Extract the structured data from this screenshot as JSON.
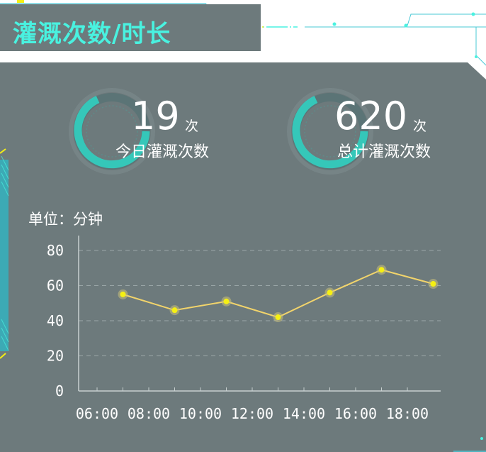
{
  "header": {
    "title": "灌溉次数/时长"
  },
  "stats": [
    {
      "value": "19",
      "unit": "次",
      "label": "今日灌溉次数"
    },
    {
      "value": "620",
      "unit": "次",
      "label": "总计灌溉次数"
    }
  ],
  "chart_unit_label": "单位：分钟",
  "colors": {
    "panel": "#6d7a7c",
    "accent": "#49f2e0",
    "line": "#f2d46b",
    "point": "#f5f013"
  },
  "chart_data": {
    "type": "line",
    "categories": [
      "06:00",
      "08:00",
      "10:00",
      "12:00",
      "14:00",
      "16:00",
      "18:00"
    ],
    "x": [
      "06:00",
      "07:00",
      "08:00",
      "09:00",
      "10:00",
      "11:00",
      "12:00",
      "13:00",
      "14:00",
      "15:00",
      "16:00",
      "17:00",
      "18:00"
    ],
    "series": [
      {
        "x": [
          "07:00",
          "09:00",
          "11:00",
          "13:00",
          "15:00",
          "17:00",
          "19:00"
        ],
        "values": [
          55,
          46,
          51,
          42,
          56,
          69,
          61
        ]
      }
    ],
    "ylim": [
      0,
      80
    ],
    "yticks": [
      0,
      20,
      40,
      60,
      80
    ],
    "grid": true
  }
}
